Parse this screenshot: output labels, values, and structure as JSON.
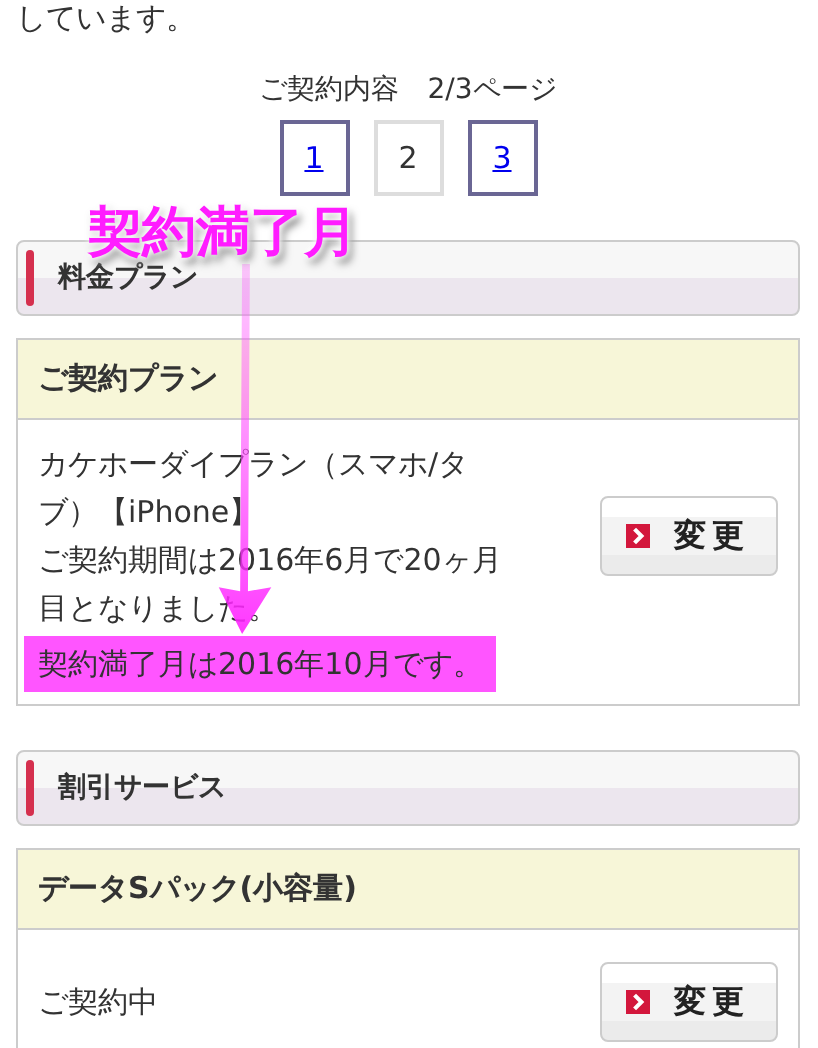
{
  "intro_text": "しています。",
  "pager": {
    "label": "ご契約内容　2/3ページ",
    "pages": [
      {
        "label": "1",
        "selected": false
      },
      {
        "label": "2",
        "selected": true
      },
      {
        "label": "3",
        "selected": false
      }
    ]
  },
  "sections": [
    {
      "title": "料金プラン",
      "card": {
        "title": "ご契約プラン",
        "lines": [
          "カケホーダイプラン（スマホ/タブ）【iPhone】",
          "ご契約期間は2016年6月で20ヶ月目となりました。"
        ],
        "highlight": "契約満了月は2016年10月です。",
        "button": "変更"
      }
    },
    {
      "title": "割引サービス",
      "card": {
        "title": "データSパック(小容量)",
        "lines": [
          "ご契約中"
        ],
        "button": "変更"
      }
    }
  ],
  "annotation": {
    "label": "契約満了月"
  }
}
